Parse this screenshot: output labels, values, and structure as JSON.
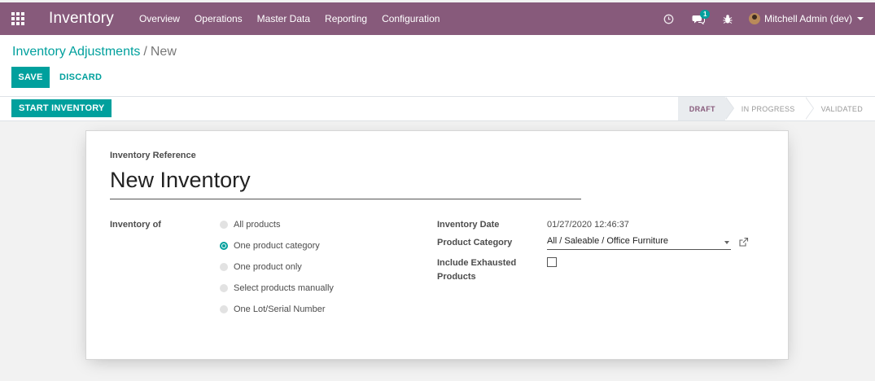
{
  "navbar": {
    "app_name": "Inventory",
    "menu": [
      "Overview",
      "Operations",
      "Master Data",
      "Reporting",
      "Configuration"
    ],
    "messages_count": "1",
    "user": "Mitchell Admin (dev)"
  },
  "control": {
    "breadcrumb_parent": "Inventory Adjustments",
    "breadcrumb_separator": "/",
    "breadcrumb_current": "New",
    "save_label": "SAVE",
    "discard_label": "DISCARD"
  },
  "status": {
    "start_label": "START INVENTORY",
    "stages": [
      "DRAFT",
      "IN PROGRESS",
      "VALIDATED"
    ],
    "active_stage": "DRAFT"
  },
  "form": {
    "reference_label": "Inventory Reference",
    "reference_value": "New Inventory",
    "inventory_of_label": "Inventory of",
    "options": [
      "All products",
      "One product category",
      "One product only",
      "Select products manually",
      "One Lot/Serial Number"
    ],
    "selected_option": "One product category",
    "date_label": "Inventory Date",
    "date_value": "01/27/2020 12:46:37",
    "category_label": "Product Category",
    "category_value": "All / Saleable / Office Furniture",
    "exhausted_label_line1": "Include Exhausted",
    "exhausted_label_line2": "Products",
    "exhausted_checked": false
  },
  "colors": {
    "navbar": "#875a7b",
    "accent": "#00a09d"
  }
}
